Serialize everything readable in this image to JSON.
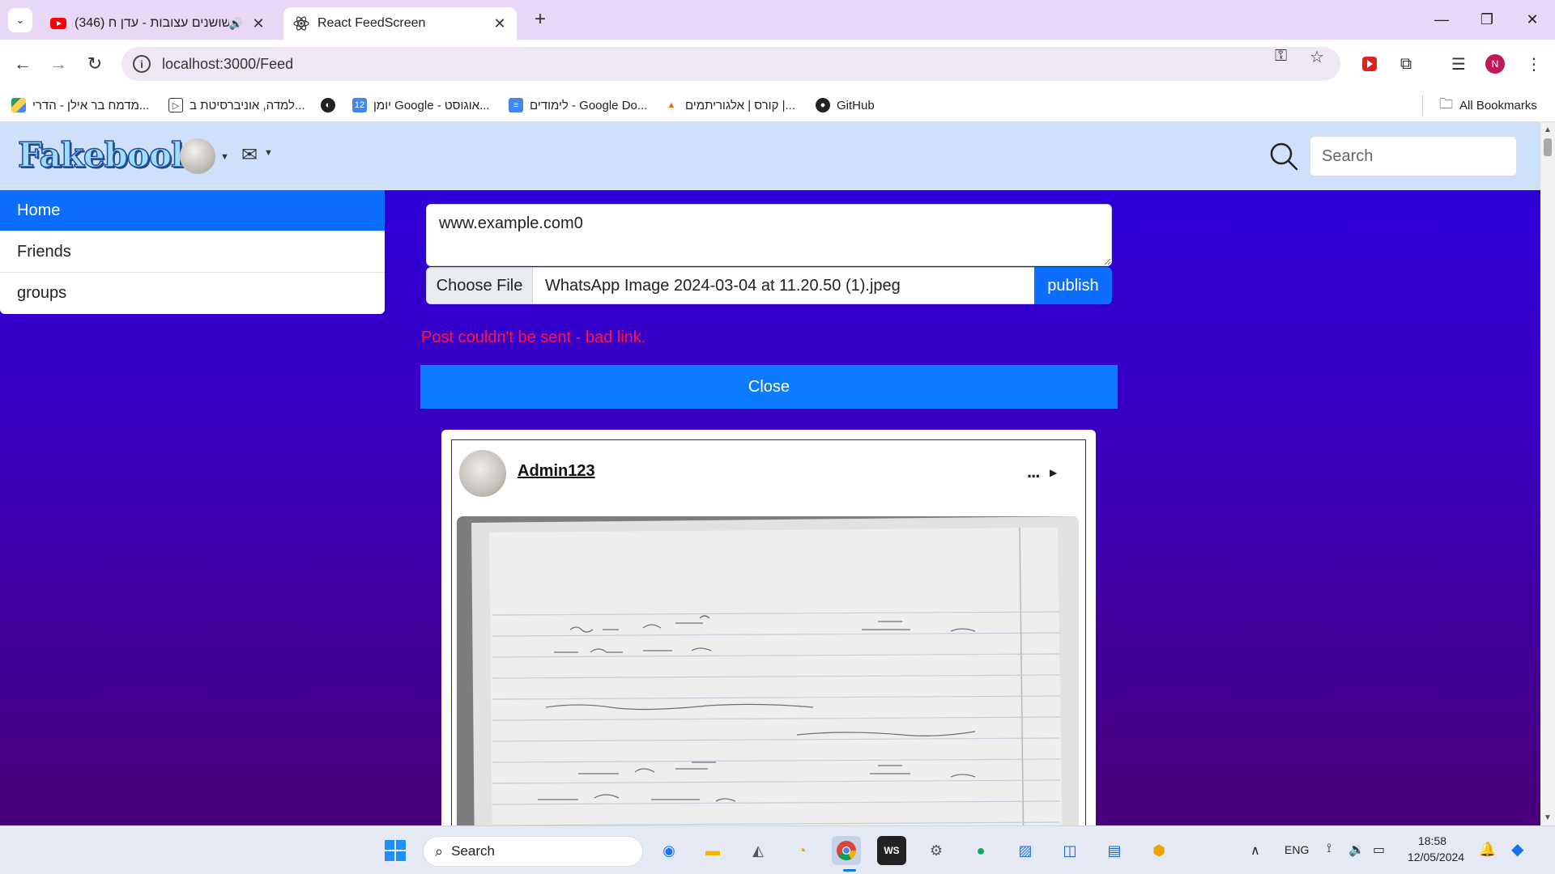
{
  "browser": {
    "tabs": [
      {
        "title": "(346) שושנים עצובות - עדן ח",
        "muted_icon": "speaker-icon",
        "close": "✕"
      },
      {
        "title": "React FeedScreen",
        "close": "✕"
      }
    ],
    "new_tab": "+",
    "url": "localhost:3000/Feed",
    "profile_initial": "N",
    "bookmarks": [
      {
        "label": "מדמח בר אילן - הדרי...",
        "icon": "google-drive-icon"
      },
      {
        "label": "למדה, אוניברסיטת ב...",
        "icon": "lamda-icon"
      },
      {
        "label": "",
        "icon": "globe-icon"
      },
      {
        "label": "יומן Google - אוגוסט...",
        "icon": "google-calendar-icon"
      },
      {
        "label": "לימודים - Google Do...",
        "icon": "google-docs-icon"
      },
      {
        "label": "קורס | אלגוריתמים |...",
        "icon": "course-icon"
      },
      {
        "label": "GitHub",
        "icon": "github-icon"
      }
    ],
    "all_bookmarks": "All Bookmarks"
  },
  "app": {
    "logo": "Fakebook",
    "search_placeholder": "Search",
    "sidebar": [
      {
        "label": "Home",
        "active": true
      },
      {
        "label": "Friends",
        "active": false
      },
      {
        "label": "groups",
        "active": false
      }
    ],
    "composer": {
      "text_value": "www.example.com0",
      "choose_file": "Choose File",
      "file_name": "WhatsApp Image 2024-03-04 at 11.20.50 (1).jpeg",
      "publish": "publish"
    },
    "error": "Post couldn't be sent - bad link.",
    "close_button": "Close",
    "post": {
      "author": "Admin123",
      "menu": "..."
    }
  },
  "taskbar": {
    "search": "Search",
    "language": "ENG",
    "time": "18:58",
    "date": "12/05/2024"
  },
  "colors": {
    "accent": "#0d6efd",
    "error": "#ff1744",
    "page_bg_top": "#2d00e2",
    "page_bg_bottom": "#4a0078",
    "navbar": "#cfe0fb"
  }
}
